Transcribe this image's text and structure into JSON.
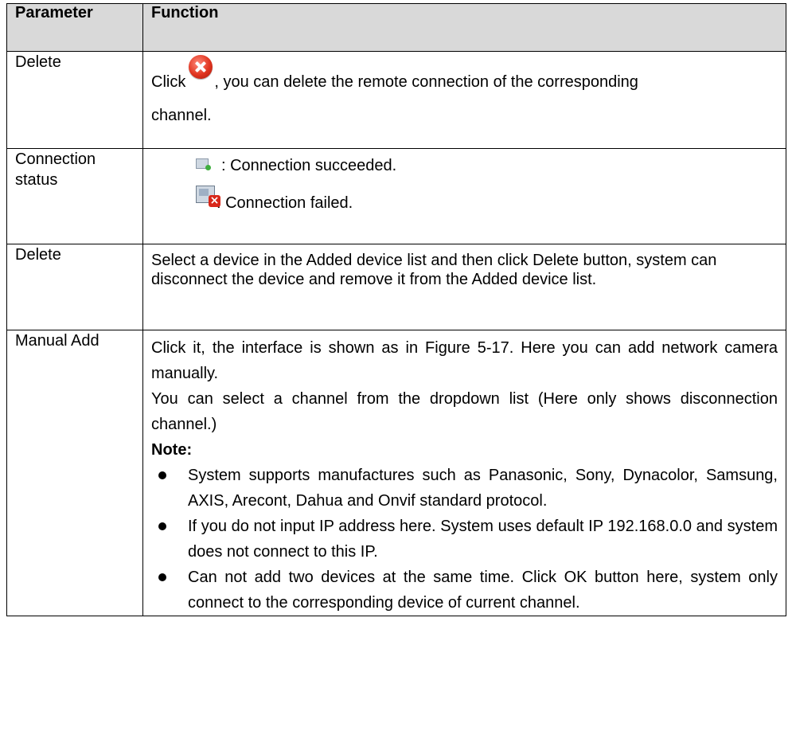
{
  "table": {
    "headers": {
      "parameter": "Parameter",
      "function": "Function"
    },
    "rows": [
      {
        "parameter": "Delete",
        "function_before_icon": "Click",
        "function_after_icon": ", you can delete the remote connection of the corresponding",
        "function_line2": "channel.",
        "icon": "close-icon"
      },
      {
        "parameter": "Connection status",
        "status_success": ": Connection succeeded.",
        "status_fail": ": Connection failed.",
        "icon_success": "connection-success-icon",
        "icon_fail": "connection-failed-icon"
      },
      {
        "parameter": "Delete",
        "function": "Select a device in the Added device list and then click Delete button, system can disconnect the device and remove it from the Added device list."
      },
      {
        "parameter": "Manual Add",
        "function_p1": "Click it, the interface is shown as in Figure 5-17. Here you can add network camera manually.",
        "function_p2": "You can select a channel from the dropdown list (Here only shows disconnection channel.)",
        "note_label": "Note:",
        "notes": [
          "System supports manufactures such as Panasonic, Sony, Dynacolor, Samsung, AXIS, Arecont, Dahua and Onvif standard protocol.",
          "If you do not input IP address here. System uses default IP 192.168.0.0 and system does not connect to this IP.",
          "Can not add two devices at the same time. Click OK button here, system only connect to the corresponding device of current channel."
        ]
      }
    ]
  }
}
